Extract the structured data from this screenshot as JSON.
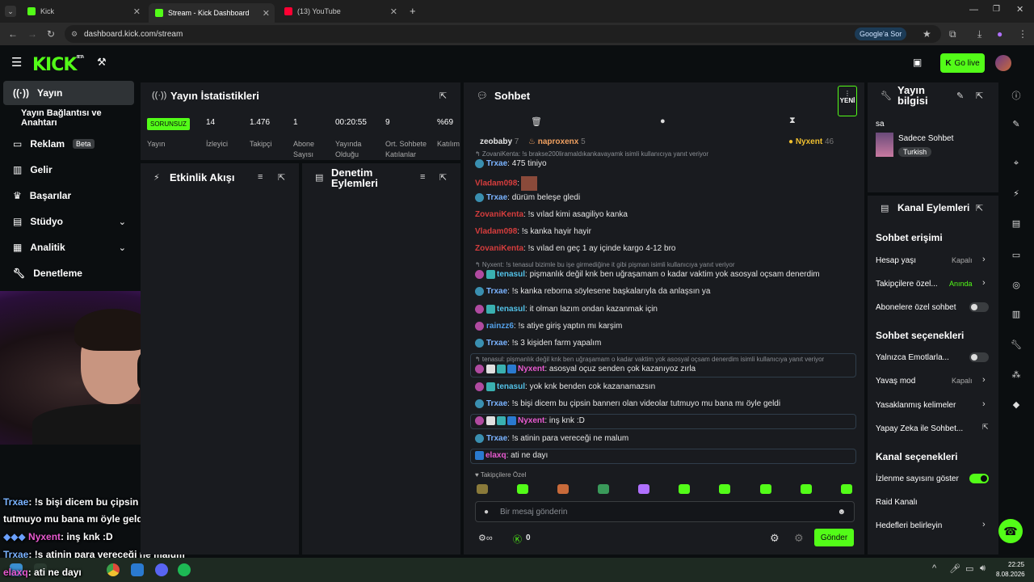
{
  "browser": {
    "tabs": [
      {
        "label": "Kick",
        "color": "#53fc18"
      },
      {
        "label": "Stream - Kick Dashboard",
        "color": "#53fc18"
      },
      {
        "label": "(13) YouTube",
        "color": "#ff0033"
      }
    ],
    "url": "dashboard.kick.com/stream",
    "google_sor": "Google'a Sor"
  },
  "header": {
    "logo": "KICK",
    "logo_sup": "BETA",
    "go_live": "Go live"
  },
  "sidebar": {
    "items": [
      {
        "label": "Yayın",
        "icon": "radio-icon"
      },
      {
        "label": "Yayın Bağlantısı ve Anahtarı"
      },
      {
        "label": "Reklam",
        "badge": "Beta",
        "icon": "ad-icon"
      },
      {
        "label": "Gelir",
        "icon": "chart-icon"
      },
      {
        "label": "Başarılar",
        "icon": "trophy-icon"
      },
      {
        "label": "Stüdyo",
        "icon": "studio-icon"
      },
      {
        "label": "Analitik",
        "icon": "analytics-icon"
      },
      {
        "label": "Denetleme",
        "icon": "wrench-icon"
      }
    ]
  },
  "overlay_chat": [
    {
      "user": "Trxae",
      "text": ": !s bişi dicem bu çipsin bannerı olan videolar"
    },
    {
      "user": "",
      "text": "tutmuyo mu bana mı öyle geldi"
    },
    {
      "user": "Nyxent",
      "text": ": inş knk :D"
    },
    {
      "user": "Trxae",
      "text": ": !s atinin para vereceği ne malum"
    },
    {
      "user": "elaxq",
      "text": ": ati ne dayı"
    }
  ],
  "stats": {
    "title": "Yayın İstatistikleri",
    "status": "SORUNSUZ",
    "status_label": "Yayın",
    "items": [
      {
        "value": "14",
        "label": "İzleyici"
      },
      {
        "value": "1.476",
        "label": "Takipçi"
      },
      {
        "value": "1",
        "label": "Abone Sayısı"
      },
      {
        "value": "00:20:55",
        "label": "Yayında Olduğu Süre"
      },
      {
        "value": "9",
        "label": "Ort. Sohbete Katılanlar"
      },
      {
        "value": "%69",
        "label": "Katılım"
      }
    ]
  },
  "activity": {
    "title": "Etkinlik Akışı"
  },
  "moderation": {
    "title": "Denetim Eylemleri"
  },
  "chat": {
    "title": "Sohbet",
    "new_label": "YENİ",
    "top_users": [
      {
        "name": "zeobaby",
        "count": "7"
      },
      {
        "name": "naproxenx",
        "count": "5"
      },
      {
        "name": "Nyxent",
        "count": "46"
      }
    ],
    "messages": [
      {
        "type": "reply",
        "text": "↰ ZovaniKenta: !s brakse200liramaldıkankavayamk isimli kullanıcıya yanıt veriyor"
      },
      {
        "user": "Trxae",
        "color": "#7ab3ff",
        "text": ": 475 tiniyo",
        "badge": "35"
      },
      {
        "user": "Vladam098",
        "color": "#d63d3d",
        "text": ":",
        "emote": true
      },
      {
        "user": "Trxae",
        "color": "#7ab3ff",
        "text": ": dürüm beleşe gledi",
        "badge": "35"
      },
      {
        "user": "ZovaniKenta",
        "color": "#d63d3d",
        "text": ": !s vılad kimi asagiliyo kanka"
      },
      {
        "user": "Vladam098",
        "color": "#d63d3d",
        "text": ": !s kanka hayir hayir"
      },
      {
        "user": "ZovaniKenta",
        "color": "#d63d3d",
        "text": ": !s vılad en geç 1 ay içinde kargo 4-12 bro"
      },
      {
        "type": "reply",
        "text": "↰ Nyxent: !s tenasul bizimle bu işe girmediğine it gibi pişman isimli kullanıcıya yanıt veriyor"
      },
      {
        "user": "tenasul",
        "color": "#53c2e8",
        "text": ": pişmanlık değil knk ben uğraşamam o kadar vaktim yok asosyal oçsam denerdim",
        "badge": "21"
      },
      {
        "user": "Trxae",
        "color": "#7ab3ff",
        "text": ": !s kanka reborna söylesene başkalarıyla da anlaşsın ya",
        "badge": "35"
      },
      {
        "user": "tenasul",
        "color": "#53c2e8",
        "text": ": it olman lazım ondan kazanmak için",
        "badge": "21"
      },
      {
        "user": "rainzz6",
        "color": "#53a0e8",
        "text": ": !s atiye giriş yaptın mı karşim",
        "badge": "20"
      },
      {
        "user": "Trxae",
        "color": "#7ab3ff",
        "text": ": !s 3 kişiden farm yapalım",
        "badge": "35"
      },
      {
        "type": "reply",
        "text": "↰ tenasul: pişmanlık değil knk ben uğraşamam o kadar vaktim yok asosyal oçsam denerdim isimli kullanıcıya yanıt veriyor"
      },
      {
        "user": "Nyxent",
        "color": "#e85ad0",
        "text": ": asosyal oçuz senden çok kazanıyoz zırla",
        "badge": "27"
      },
      {
        "user": "tenasul",
        "color": "#53c2e8",
        "text": ": yok knk benden cok kazanamazsın",
        "badge": "21"
      },
      {
        "user": "Trxae",
        "color": "#7ab3ff",
        "text": ": !s bişi dicem bu çipsin bannerı olan videolar tutmuyo mu bana mı öyle geldi",
        "badge": "35"
      },
      {
        "user": "Nyxent",
        "color": "#e85ad0",
        "text": ": inş knk :D",
        "badge": "27"
      },
      {
        "user": "Trxae",
        "color": "#7ab3ff",
        "text": ": !s atinin para vereceği ne malum",
        "badge": "35"
      },
      {
        "user": "elaxq",
        "color": "#e85ad0",
        "text": ": ati ne dayı"
      }
    ],
    "emote_label": "♥ Takipçilere Özel",
    "input_placeholder": "Bir mesaj gönderin",
    "points": "0",
    "send": "Gönder"
  },
  "stream_info": {
    "title": "Yayın bilgisi",
    "name": "sa",
    "category": "Sadece Sohbet",
    "tag": "Turkish"
  },
  "channel_actions": {
    "title": "Kanal Eylemleri",
    "chat_access_title": "Sohbet erişimi",
    "chat_access": [
      {
        "label": "Hesap yaşı",
        "value": "Kapalı"
      },
      {
        "label": "Takipçilere özel...",
        "value": "Anında"
      },
      {
        "label": "Abonelere özel sohbet",
        "value": ""
      }
    ],
    "chat_options_title": "Sohbet seçenekleri",
    "chat_options": [
      {
        "label": "Yalnızca Emotlarla...",
        "value": ""
      },
      {
        "label": "Yavaş mod",
        "value": "Kapalı"
      },
      {
        "label": "Yasaklanmış kelimeler",
        "value": ""
      },
      {
        "label": "Yapay Zeka ile Sohbet...",
        "value": ""
      }
    ],
    "channel_options_title": "Kanal seçenekleri",
    "channel_options": [
      {
        "label": "İzlenme sayısını göster",
        "value": ""
      },
      {
        "label": "Raid Kanalı",
        "value": ""
      },
      {
        "label": "Hedefleri belirleyin",
        "value": ""
      }
    ]
  },
  "taskbar": {
    "time": "22:25",
    "date": "8.08.2026"
  },
  "colors": {
    "accent": "#53fc18",
    "panel": "#191b1f",
    "bg": "#0b0e10"
  }
}
